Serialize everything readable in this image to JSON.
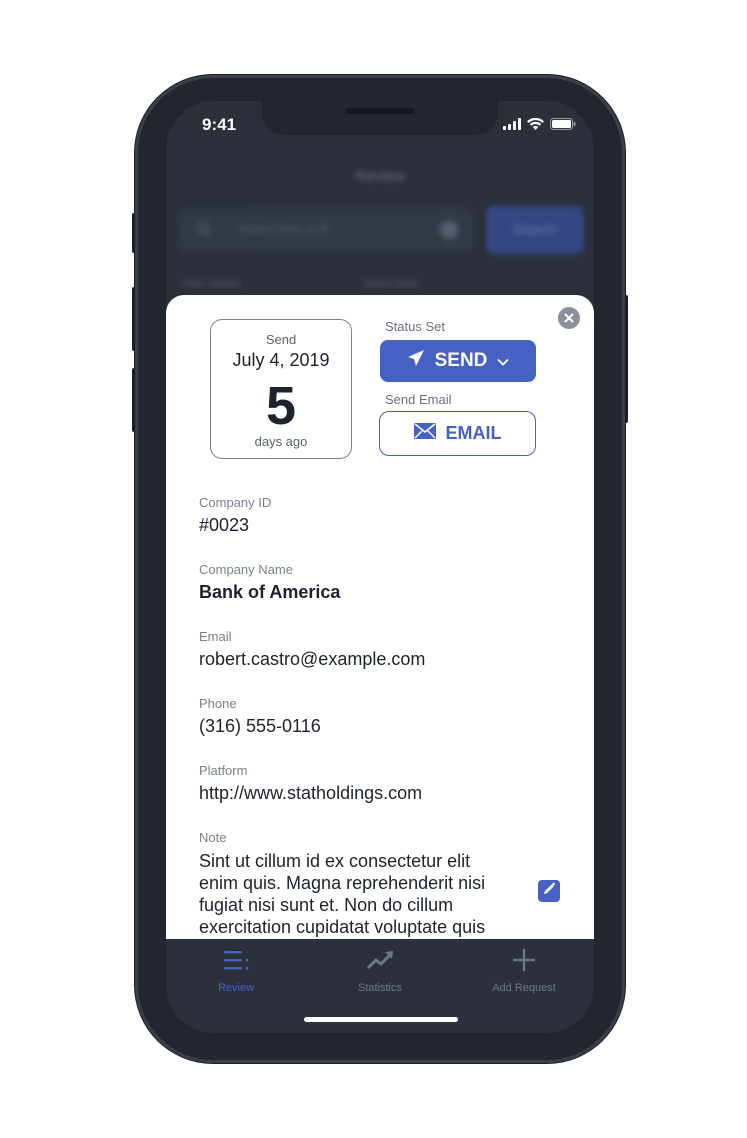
{
  "status_bar": {
    "time": "9:41"
  },
  "background": {
    "title": "Review",
    "search_placeholder": "Search here to fil",
    "search_button": "Search",
    "filter_status_label": "Filter Status",
    "select_date_label": "Select Date"
  },
  "modal": {
    "date_box": {
      "caption": "Send",
      "date": "July 4, 2019",
      "days": "5",
      "days_caption": "days ago"
    },
    "status_set_label": "Status Set",
    "send_button": "SEND",
    "send_email_label": "Send Email",
    "email_button": "EMAIL",
    "fields": {
      "company_id": {
        "label": "Company ID",
        "value": "#0023"
      },
      "company_name": {
        "label": "Company Name",
        "value": "Bank of America"
      },
      "email": {
        "label": "Email",
        "value": "robert.castro@example.com"
      },
      "phone": {
        "label": "Phone",
        "value": "(316) 555-0116"
      },
      "platform": {
        "label": "Platform",
        "value": "http://www.statholdings.com"
      },
      "note": {
        "label": "Note",
        "value": "Sint ut cillum id ex consectetur elit enim quis. Magna reprehenderit nisi fugiat nisi sunt et. Non do cillum exercitation cupidatat voluptate quis"
      }
    }
  },
  "tabbar": {
    "items": [
      {
        "label": "Review",
        "icon": "list-icon",
        "active": true
      },
      {
        "label": "Statistics",
        "icon": "trending-up-icon",
        "active": false
      },
      {
        "label": "Add Request",
        "icon": "plus-icon",
        "active": false
      }
    ]
  },
  "colors": {
    "accent": "#4661c4",
    "screen_bg": "#2b303b",
    "phone_frame": "#22262f"
  }
}
